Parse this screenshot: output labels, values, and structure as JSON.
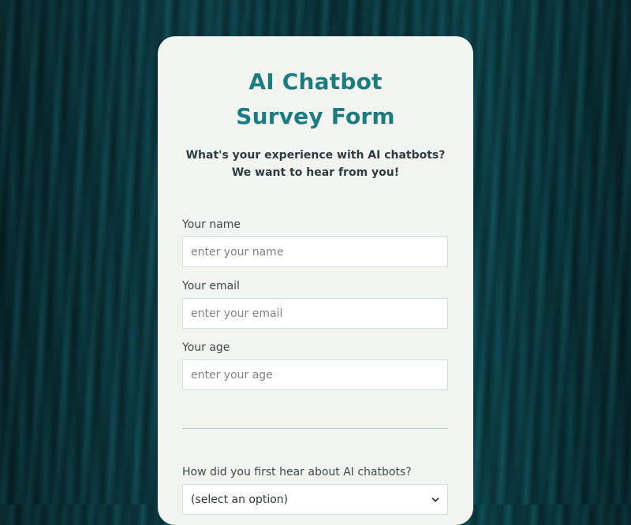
{
  "form": {
    "title_line1": "AI Chatbot",
    "title_line2": "Survey Form",
    "subtitle_line1": "What's your experience with AI chatbots?",
    "subtitle_line2": "We want to hear from you!",
    "fields": [
      {
        "label": "Your name",
        "placeholder": "enter your name"
      },
      {
        "label": "Your email",
        "placeholder": "enter your email"
      },
      {
        "label": "Your age",
        "placeholder": "enter your age"
      }
    ],
    "question": {
      "label": "How did you first hear about AI chatbots?",
      "selected": "(select an option)"
    }
  },
  "colors": {
    "accent": "#1b7c82",
    "card_bg": "#f2f4ef",
    "page_bg": "#0f4650"
  },
  "icons": {
    "select": "chevron-down-icon"
  }
}
